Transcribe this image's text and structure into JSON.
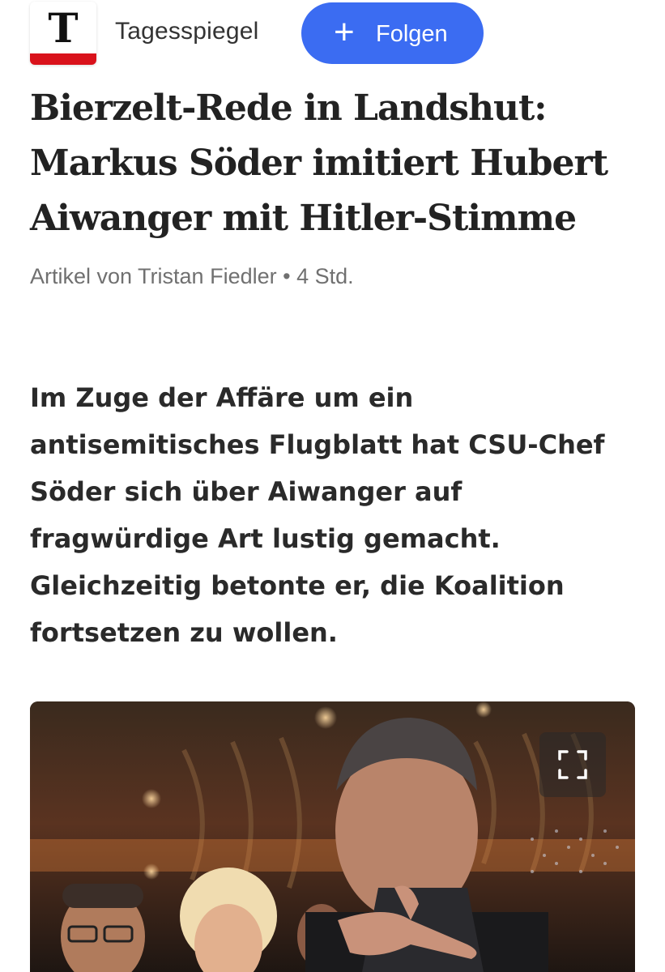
{
  "publisher": {
    "logo_letter": "T",
    "name": "Tagesspiegel",
    "follow_label": "Folgen",
    "follow_icon": "plus-icon"
  },
  "article": {
    "headline": "Bierzelt-Rede in Landshut: Markus Söder imitiert Hubert Aiwanger mit Hitler-Stimme",
    "byline": "Artikel von Tristan Fiedler • 4 Std.",
    "lead": "Im Zuge der Affäre um ein antisemitisches Flugblatt hat CSU-Chef Söder sich über Aiwanger auf fragwürdige Art lustig gemacht. Gleichzeitig betonte er, die Koalition fortsetzen zu wollen."
  },
  "image": {
    "expand_icon": "fullscreen-icon"
  },
  "colors": {
    "accent": "#3b6cf2",
    "brand_red": "#d9121b",
    "byline_gray": "#707070"
  }
}
